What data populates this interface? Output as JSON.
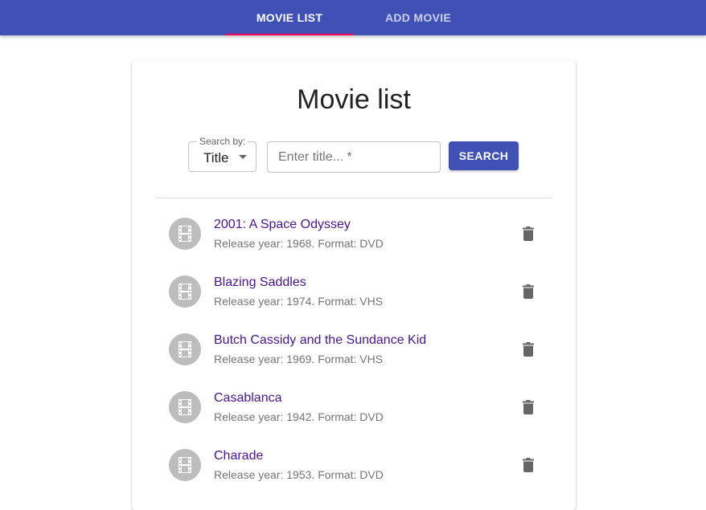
{
  "appbar": {
    "tabs": [
      {
        "label": "MOVIE LIST"
      },
      {
        "label": "ADD MOVIE"
      }
    ],
    "active_tab": "MOVIE LIST",
    "accent_color": "#3f51b5",
    "indicator_color": "#f50057"
  },
  "main": {
    "title": "Movie list",
    "search": {
      "by_label": "Search by:",
      "by_value": "Title",
      "input_value": "",
      "input_placeholder": "Enter title... *",
      "button_label": "SEARCH"
    },
    "movies": [
      {
        "title": "2001: A Space Odyssey",
        "subtitle": "Release year: 1968. Format: DVD",
        "icon": "film-icon",
        "action_icon": "trash-icon"
      },
      {
        "title": "Blazing Saddles",
        "subtitle": "Release year: 1974. Format: VHS",
        "icon": "film-icon",
        "action_icon": "trash-icon"
      },
      {
        "title": "Butch Cassidy and the Sundance Kid",
        "subtitle": "Release year: 1969. Format: VHS",
        "icon": "film-icon",
        "action_icon": "trash-icon"
      },
      {
        "title": "Casablanca",
        "subtitle": "Release year: 1942. Format: DVD",
        "icon": "film-icon",
        "action_icon": "trash-icon"
      },
      {
        "title": "Charade",
        "subtitle": "Release year: 1953. Format: DVD",
        "icon": "film-icon",
        "action_icon": "trash-icon"
      }
    ],
    "title_link_color": "#4a148c"
  }
}
